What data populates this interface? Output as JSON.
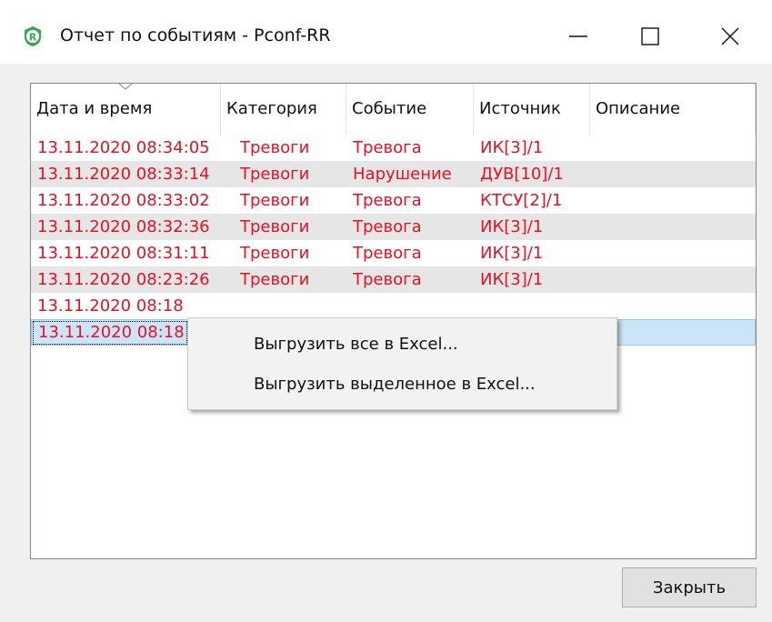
{
  "window": {
    "title": "Отчет по событиям - Pconf-RR",
    "icon": "app-logo-icon",
    "controls": [
      "minimize-icon",
      "maximize-icon",
      "close-icon"
    ]
  },
  "table": {
    "columns": [
      "Дата и время",
      "Категория",
      "Событие",
      "Источник",
      "Описание"
    ],
    "sort_indicator": "chevron-down-icon",
    "rows": [
      {
        "datetime": "13.11.2020 08:34:05",
        "category": "Тревоги",
        "event": "Тревога",
        "source": "ИК[3]/1",
        "description": ""
      },
      {
        "datetime": "13.11.2020 08:33:14",
        "category": "Тревоги",
        "event": "Нарушение",
        "source": "ДУВ[10]/1",
        "description": ""
      },
      {
        "datetime": "13.11.2020 08:33:02",
        "category": "Тревоги",
        "event": "Тревога",
        "source": "КТСУ[2]/1",
        "description": ""
      },
      {
        "datetime": "13.11.2020 08:32:36",
        "category": "Тревоги",
        "event": "Тревога",
        "source": "ИК[3]/1",
        "description": ""
      },
      {
        "datetime": "13.11.2020 08:31:11",
        "category": "Тревоги",
        "event": "Тревога",
        "source": "ИК[3]/1",
        "description": ""
      },
      {
        "datetime": "13.11.2020 08:23:26",
        "category": "Тревоги",
        "event": "Тревога",
        "source": "ИК[3]/1",
        "description": ""
      },
      {
        "datetime": "13.11.2020 08:18",
        "category": "",
        "event": "",
        "source": "",
        "description": ""
      },
      {
        "datetime": "13.11.2020 08:18",
        "category": "",
        "event": "",
        "source": "",
        "description": ""
      }
    ],
    "selected_row": 7
  },
  "context_menu": {
    "items": [
      "Выгрузить все в Excel...",
      "Выгрузить выделенное в Excel..."
    ]
  },
  "buttons": {
    "close": "Закрыть"
  },
  "colors": {
    "alarm_text": "#e81123",
    "selection": "#cce4f7",
    "alt_row": "#e6e6e6",
    "logo_green": "#3aa655"
  }
}
